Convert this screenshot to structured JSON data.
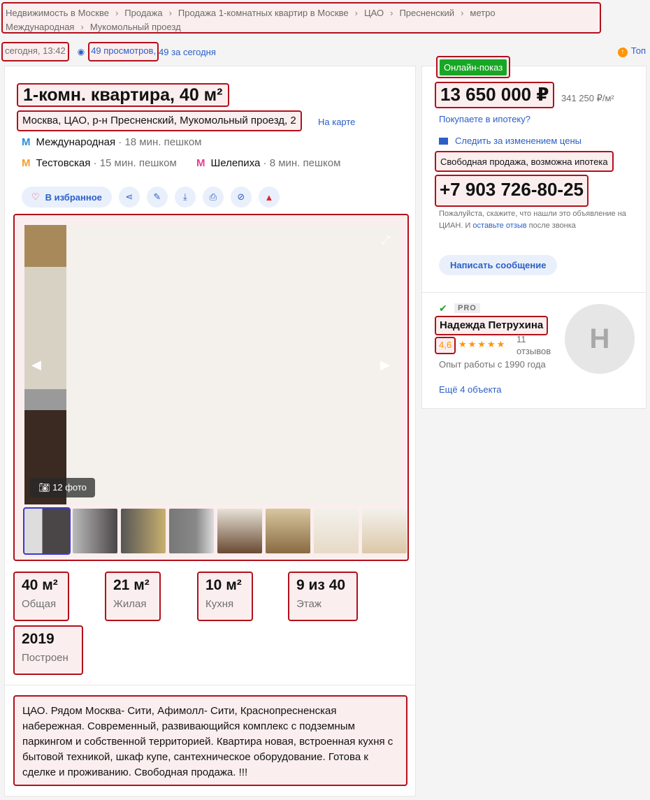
{
  "breadcrumbs": [
    "Недвижимость в Москве",
    "Продажа",
    "Продажа 1-комнатных квартир в Москве",
    "ЦАО",
    "Пресненский",
    "метро Международная",
    "Мукомольный проезд"
  ],
  "meta": {
    "date": "сегодня, 13:42",
    "views": "49 просмотров,",
    "views_today": "49 за сегодня",
    "top": "Топ"
  },
  "listing": {
    "title": "1-комн. квартира, 40 м²",
    "address": "Москва, ЦАО, р-н Пресненский, Мукомольный проезд, 2",
    "map_link": "На карте",
    "metro": [
      {
        "name": "Международная",
        "time": "· 18 мин. пешком",
        "color": "#2b8fd8"
      },
      {
        "name": "Тестовская",
        "time": "· 15 мин. пешком",
        "color": "#f2a02c"
      },
      {
        "name": "Шелепиха",
        "time": "· 8 мин. пешком",
        "color": "#e43f8f"
      }
    ],
    "favorite_label": "В избранное",
    "photo_count": "12 фото",
    "features": [
      {
        "value": "40 м²",
        "label": "Общая"
      },
      {
        "value": "21 м²",
        "label": "Жилая"
      },
      {
        "value": "10 м²",
        "label": "Кухня"
      },
      {
        "value": "9 из 40",
        "label": "Этаж"
      },
      {
        "value": "2019",
        "label": "Построен"
      }
    ],
    "description": "ЦАО. Рядом  Москва- Сити, Афимолл- Сити, Краснопресненская набережная. Современный, развивающийся комплекс с подземным паркингом и собственной территорией. Квартира новая, встроенная кухня с бытовой техникой, шкаф купе, сантехническое оборудование. Готова к сделке и проживанию. Свободная продажа. !!!"
  },
  "sidebar": {
    "badge": "Онлайн-показ",
    "price": "13 650 000 ₽",
    "price_per_m": "341 250 ₽/м²",
    "mortgage_link": "Покупаете в ипотеку?",
    "follow_price": "Следить за изменением цены",
    "conditions": "Свободная продажа, возможна ипотека",
    "phone": "+7 903 726-80-25",
    "note_pre": "Пожалуйста, скажите, что нашли это объявление на ЦИАН. И ",
    "note_link": "оставьте отзыв",
    "note_post": " после звонка",
    "message_button": "Написать сообщение",
    "agent": {
      "pro": "PRO",
      "name": "Надежда Петрухина",
      "rating": "4,6",
      "stars": 4.6,
      "reviews": "11 отзывов",
      "experience": "Опыт работы с 1990 года",
      "more": "Ещё 4 объекта",
      "avatar_letter": "Н"
    }
  }
}
